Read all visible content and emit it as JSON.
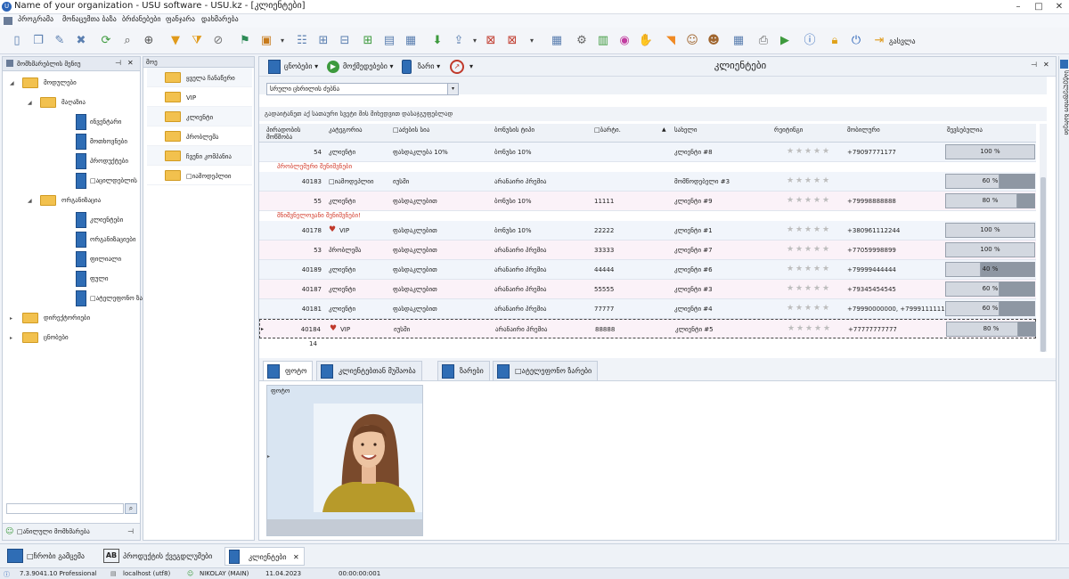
{
  "window": {
    "title": "Name of your organization - USU software - USU.kz - [კლიენტები]",
    "controls": [
      "–",
      "□",
      "✕"
    ]
  },
  "menu": [
    "პროგრამა",
    "მონაცემთა ბაზა",
    "ბრძანებები",
    "ფანჯარა",
    "დახმარება"
  ],
  "toolbar": {
    "exit_label": "გასვლა"
  },
  "nav": {
    "header": "მომხმარებლის მენიუ",
    "tree": [
      {
        "label": "მოდულები",
        "level": 0,
        "expanded": true,
        "type": "folder"
      },
      {
        "label": "მაღაზია",
        "level": 1,
        "expanded": true,
        "type": "folder"
      },
      {
        "label": "ინვენტარი",
        "level": 2,
        "type": "doc"
      },
      {
        "label": "მოთხოვნები",
        "level": 2,
        "type": "doc"
      },
      {
        "label": "პროდუქტები",
        "level": 2,
        "type": "doc"
      },
      {
        "label": "□აცილდებლის",
        "level": 2,
        "type": "doc"
      },
      {
        "label": "ორგანიზაცია",
        "level": 1,
        "expanded": true,
        "type": "folder"
      },
      {
        "label": "კლიენტები",
        "level": 2,
        "type": "doc"
      },
      {
        "label": "ორგანიზაციები",
        "level": 2,
        "type": "doc"
      },
      {
        "label": "ფილიალი",
        "level": 2,
        "type": "doc"
      },
      {
        "label": "ფული",
        "level": 2,
        "type": "doc"
      },
      {
        "label": "□ატელეფონო ზარები",
        "level": 2,
        "type": "doc"
      },
      {
        "label": "დირექტორიები",
        "level": 0,
        "expanded": false,
        "type": "folder"
      },
      {
        "label": "ცნობები",
        "level": 0,
        "expanded": false,
        "type": "folder"
      }
    ],
    "search_placeholder": "",
    "preferences_label": "□ანილული მომხმარება"
  },
  "views": {
    "header": "მოე",
    "items": [
      "ყველა ჩანაწერი",
      "VIP",
      "კლიენტი",
      "პრობლემა",
      "ჩვენი კომპანია",
      "□იამოდეპლიი"
    ]
  },
  "main": {
    "title": "კლიენტები",
    "toolbar": {
      "reports": "ცნობები",
      "actions": "მოქმედებები",
      "calls": "ზარი"
    },
    "filter_value": "სრული ცხრილის ძებნა",
    "group_hint": "გადაიტანეთ აქ სათაური სვეტი მის მიხედვით დასაჯგუფებლად",
    "columns": [
      "პირადობის მოწმობა",
      "კატეგორია",
      "□აძების სია",
      "ბონუსის ტიპი",
      "□ბარტი.",
      "სახელი",
      "რეიტინგი",
      "მობილური",
      "შევსებულია"
    ],
    "row_count": "14",
    "rows": [
      {
        "kind": "row",
        "id": "54",
        "cat": "კლიენტი",
        "price": "ფასდაკლება 10%",
        "bonus": "ბონუსი 10%",
        "card": "",
        "name": "კლიენტი #8",
        "rating": 0,
        "mobile": "+79097771177",
        "filled": "100 %",
        "filled_value": 100,
        "tone": "alt"
      },
      {
        "kind": "group",
        "label": "პრობლემური შენიშვნები"
      },
      {
        "kind": "row",
        "id": "40183",
        "cat": "□იამოდეპლიი",
        "price": "იუსმი",
        "bonus": "არანაირი პრემია",
        "card": "",
        "name": "მომწოდებელი #3",
        "rating": 0,
        "mobile": "",
        "filled": "60 %",
        "filled_value": 60,
        "tone": "alt"
      },
      {
        "kind": "row",
        "id": "55",
        "cat": "კლიენტი",
        "price": "ფასდაკლებით",
        "bonus": "ბონუსი 10%",
        "card": "11111",
        "name": "კლიენტი #9",
        "rating": 0,
        "mobile": "+79998888888",
        "filled": "80 %",
        "filled_value": 80,
        "tone": "pink"
      },
      {
        "kind": "group",
        "label": "მნიშვნელოვანი შენიშვნები!"
      },
      {
        "kind": "row",
        "id": "40178",
        "cat": "VIP",
        "heart": true,
        "price": "ფასდაკლებით",
        "bonus": "ბონუსი 10%",
        "card": "22222",
        "name": "კლიენტი #1",
        "rating": 0,
        "mobile": "+380961112244",
        "filled": "100 %",
        "filled_value": 100,
        "tone": "alt"
      },
      {
        "kind": "row",
        "id": "53",
        "cat": "პრობლემა",
        "price": "ფასდაკლებით",
        "bonus": "არანაირი პრემია",
        "card": "33333",
        "name": "კლიენტი #7",
        "rating": 0,
        "mobile": "+77059998899",
        "filled": "100 %",
        "filled_value": 100,
        "tone": "pink"
      },
      {
        "kind": "row",
        "id": "40189",
        "cat": "კლიენტი",
        "price": "ფასდაკლებით",
        "bonus": "არანაირი პრემია",
        "card": "44444",
        "name": "კლიენტი #6",
        "rating": 0,
        "mobile": "+79999444444",
        "filled": "40 %",
        "filled_value": 40,
        "tone": "alt"
      },
      {
        "kind": "row",
        "id": "40187",
        "cat": "კლიენტი",
        "price": "ფასდაკლებით",
        "bonus": "არანაირი პრემია",
        "card": "55555",
        "name": "კლიენტი #3",
        "rating": 0,
        "mobile": "+79345454545",
        "filled": "60 %",
        "filled_value": 60,
        "tone": "pink"
      },
      {
        "kind": "row",
        "id": "40181",
        "cat": "კლიენტი",
        "price": "ფასდაკლებით",
        "bonus": "არანაირი პრემია",
        "card": "77777",
        "name": "კლიენტი #4",
        "rating": 0,
        "mobile": "+79990000000, +79991111111",
        "filled": "60 %",
        "filled_value": 60,
        "tone": "alt"
      },
      {
        "kind": "row",
        "id": "40184",
        "cat": "VIP",
        "heart": true,
        "price": "იუსმი",
        "bonus": "არანაირი პრემია",
        "card": "88888",
        "name": "კლიენტი #5",
        "rating": 0,
        "mobile": "+77777777777",
        "filled": "80 %",
        "filled_value": 80,
        "tone": "pink",
        "selected": true
      }
    ],
    "detail_tabs": [
      "ფოტო",
      "კლიენტებთან მუშაობა",
      "ზარები",
      "□ატელეფონო ზარები"
    ],
    "photo_caption": "ფოტო"
  },
  "right_tab": "სატელეფონო ზარები",
  "taskbar": [
    "□ჩრობი გამცემა",
    "პროდუქტის ქვეგდლუმები",
    "კლიენტები"
  ],
  "statusbar": {
    "version": "7.3.9041.10 Professional",
    "db": "localhost (utf8)",
    "user": "NIKOLAY (MAIN)",
    "date": "11.04.2023",
    "timer": "00:00:00:001"
  },
  "colors": {
    "accent": "#2f6db5",
    "folder": "#f2c14e",
    "group_text": "#d23a2a",
    "heart": "#c0392b"
  }
}
